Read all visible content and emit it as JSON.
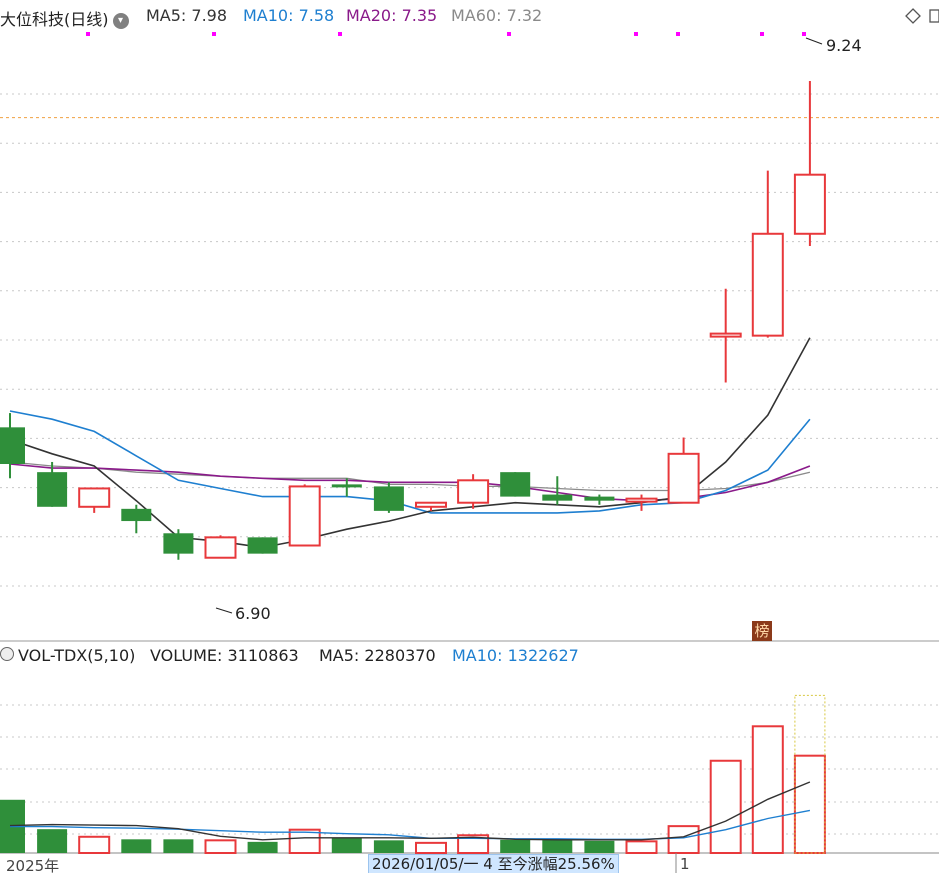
{
  "header": {
    "stock_name": "大位科技(日线)",
    "ma5": "MA5: 7.98",
    "ma10": "MA10: 7.58",
    "ma20": "MA20: 7.35",
    "ma60": "MA60: 7.32"
  },
  "volume_header": {
    "indicator": "VOL-TDX(5,10)",
    "volume": "VOLUME: 3110863",
    "ma5": "MA5: 2280370",
    "ma10": "MA10: 1322627"
  },
  "annotations": {
    "high_label": "9.24",
    "low_label": "6.90",
    "bang_icon": "榜"
  },
  "footer": {
    "year_label": "2025年",
    "date_range": "2026/01/05/一 4 至今涨幅25.56%",
    "month_marker": "1"
  },
  "colors": {
    "up": "#e8383b",
    "down": "#2f8f3a",
    "ma5": "#333333",
    "ma10": "#1e7fd0",
    "ma20": "#8a1a8a",
    "ma60": "#8a8a8a",
    "high_line": "#f0a040",
    "marker": "#ff00ff"
  },
  "chart_data": {
    "type": "candlestick",
    "price_range": [
      6.56,
      9.5
    ],
    "candles": [
      {
        "open": 7.54,
        "close": 7.36,
        "high": 7.61,
        "low": 7.29,
        "dir": "down"
      },
      {
        "open": 7.32,
        "close": 7.15,
        "high": 7.37,
        "low": 7.15,
        "dir": "down"
      },
      {
        "open": 7.15,
        "close": 7.24,
        "high": 7.24,
        "low": 7.12,
        "dir": "up"
      },
      {
        "open": 7.14,
        "close": 7.08,
        "high": 7.16,
        "low": 7.02,
        "dir": "down"
      },
      {
        "open": 7.02,
        "close": 6.92,
        "high": 7.04,
        "low": 6.89,
        "dir": "down"
      },
      {
        "open": 6.9,
        "close": 7.0,
        "high": 7.01,
        "low": 6.9,
        "dir": "up"
      },
      {
        "open": 7.0,
        "close": 6.92,
        "high": 7.0,
        "low": 6.92,
        "dir": "down"
      },
      {
        "open": 6.96,
        "close": 7.25,
        "high": 7.26,
        "low": 6.96,
        "dir": "up"
      },
      {
        "open": 7.26,
        "close": 7.25,
        "high": 7.29,
        "low": 7.2,
        "dir": "down"
      },
      {
        "open": 7.25,
        "close": 7.13,
        "high": 7.27,
        "low": 7.12,
        "dir": "down"
      },
      {
        "open": 7.15,
        "close": 7.17,
        "high": 7.17,
        "low": 7.13,
        "dir": "up"
      },
      {
        "open": 7.17,
        "close": 7.28,
        "high": 7.31,
        "low": 7.14,
        "dir": "up"
      },
      {
        "open": 7.32,
        "close": 7.2,
        "high": 7.32,
        "low": 7.2,
        "dir": "down"
      },
      {
        "open": 7.21,
        "close": 7.18,
        "high": 7.3,
        "low": 7.16,
        "dir": "down"
      },
      {
        "open": 7.2,
        "close": 7.18,
        "high": 7.21,
        "low": 7.16,
        "dir": "down"
      },
      {
        "open": 7.19,
        "close": 7.18,
        "high": 7.21,
        "low": 7.13,
        "dir": "up"
      },
      {
        "open": 7.17,
        "close": 7.41,
        "high": 7.49,
        "low": 7.17,
        "dir": "up"
      },
      {
        "open": 8.0,
        "close": 8.0,
        "high": 8.22,
        "low": 7.76,
        "dir": "up"
      },
      {
        "open": 7.99,
        "close": 8.49,
        "high": 8.8,
        "low": 7.98,
        "dir": "up"
      },
      {
        "open": 8.49,
        "close": 8.78,
        "high": 9.24,
        "low": 8.43,
        "dir": "up"
      }
    ],
    "ma5": [
      7.48,
      7.41,
      7.35,
      7.18,
      7.0,
      6.98,
      6.95,
      6.99,
      7.04,
      7.08,
      7.13,
      7.15,
      7.17,
      7.16,
      7.15,
      7.17,
      7.2,
      7.37,
      7.6,
      7.98
    ],
    "ma10": [
      7.62,
      7.58,
      7.52,
      7.4,
      7.28,
      7.24,
      7.2,
      7.2,
      7.2,
      7.18,
      7.12,
      7.12,
      7.12,
      7.12,
      7.13,
      7.16,
      7.17,
      7.23,
      7.33,
      7.58
    ],
    "ma20": [
      7.36,
      7.34,
      7.34,
      7.33,
      7.32,
      7.3,
      7.29,
      7.28,
      7.28,
      7.27,
      7.27,
      7.27,
      7.25,
      7.22,
      7.19,
      7.18,
      7.19,
      7.22,
      7.27,
      7.35
    ],
    "ma60": [
      7.37,
      7.35,
      7.34,
      7.32,
      7.31,
      7.3,
      7.29,
      7.29,
      7.29,
      7.26,
      7.26,
      7.25,
      7.25,
      7.24,
      7.23,
      7.23,
      7.23,
      7.24,
      7.27,
      7.32
    ],
    "volume": {
      "range": [
        0,
        3650000
      ],
      "bars": [
        1050000,
        470000,
        320000,
        270000,
        270000,
        250000,
        220000,
        460000,
        290000,
        250000,
        200000,
        350000,
        260000,
        260000,
        240000,
        230000,
        530000,
        1820000,
        2500000,
        1920000
      ],
      "current_ghost": 3110863,
      "ma5": [
        540000,
        560000,
        550000,
        540000,
        480000,
        330000,
        260000,
        300000,
        300000,
        300000,
        290000,
        310000,
        270000,
        260000,
        260000,
        260000,
        320000,
        630000,
        1060000,
        1400000
      ],
      "ma10": [
        520000,
        520000,
        500000,
        490000,
        470000,
        440000,
        410000,
        410000,
        380000,
        360000,
        290000,
        290000,
        280000,
        280000,
        270000,
        270000,
        300000,
        460000,
        680000,
        840000
      ]
    }
  }
}
